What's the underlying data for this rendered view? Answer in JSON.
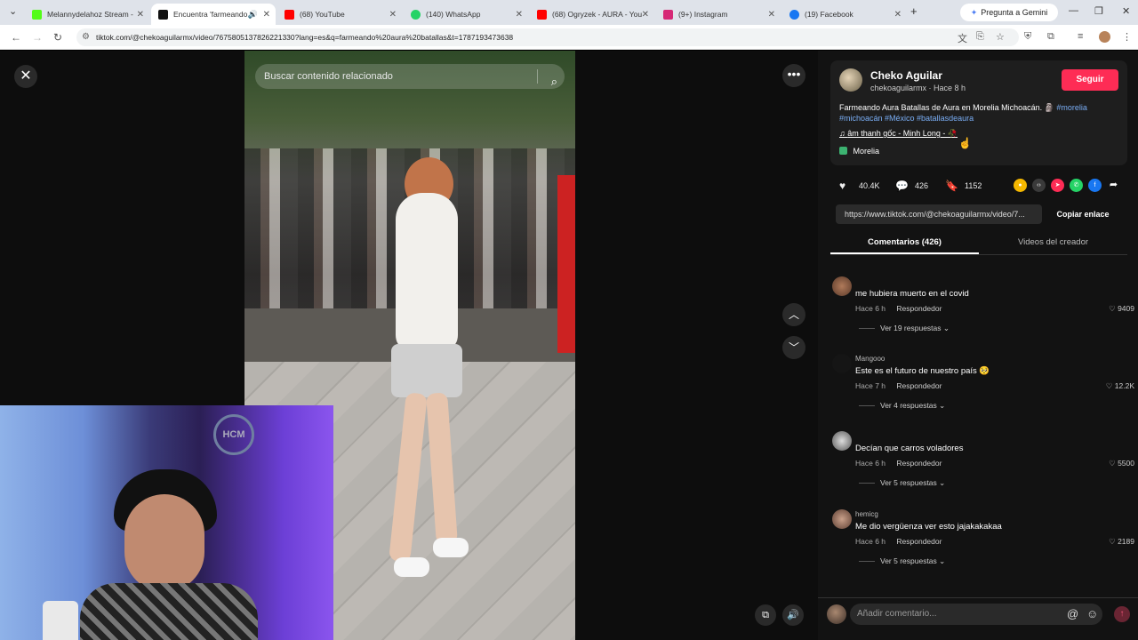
{
  "browser": {
    "tabs": [
      {
        "title": "Melannydelahoz Stream -",
        "color": "#53fc18"
      },
      {
        "title": "Encuentra 'farmeando",
        "color": "#111111",
        "active": true
      },
      {
        "title": "(68) YouTube",
        "color": "#ff0000"
      },
      {
        "title": "(140) WhatsApp",
        "color": "#25d366"
      },
      {
        "title": "(68) Ogryzek - AURA - You",
        "color": "#ff0000"
      },
      {
        "title": "(9+) Instagram",
        "color": "#d62976"
      },
      {
        "title": "(19) Facebook",
        "color": "#1877f2"
      }
    ],
    "gemini_label": "Pregunta a Gemini",
    "url": "tiktok.com/@chekoaguilarmx/video/7675805137826221330?lang=es&q=farmeando%20aura%20batallas&t=1787193473638"
  },
  "video": {
    "search_placeholder": "Buscar contenido relacionado",
    "webcam_logo": "HCM"
  },
  "creator": {
    "name": "Cheko Aguilar",
    "handle_time": "chekoaguilarmx · Hace 8 h",
    "follow_label": "Seguir",
    "description": "Farmeando Aura Batallas de Aura en Morelia Michoacán. 🗿",
    "tags_line1": "#morelia",
    "tags_line2": "#michoacán #México #batallasdeaura",
    "music": "âm thanh gốc - Minh Long - 🥀",
    "location": "Morelia"
  },
  "stats": {
    "likes": "40.4K",
    "comments": "426",
    "saves": "1152"
  },
  "share": {
    "link": "https://www.tiktok.com/@chekoaguilarmx/video/7...",
    "copy_label": "Copiar enlace"
  },
  "tabs": {
    "comments": "Comentarios (426)",
    "creator_videos": "Videos del creador"
  },
  "comments": [
    {
      "author": "",
      "text": "me hubiera muerto en el covid",
      "time": "Hace 6 h",
      "reply": "Respondedor",
      "likes": "9409",
      "more": "Ver 19 respuestas"
    },
    {
      "author": "Mangooo",
      "text": "Este es el futuro de nuestro país 🥺",
      "time": "Hace 7 h",
      "reply": "Respondedor",
      "likes": "12.2K",
      "more": "Ver 4 respuestas"
    },
    {
      "author": "",
      "text": "Decían que carros voladores",
      "time": "Hace 6 h",
      "reply": "Respondedor",
      "likes": "5500",
      "more": "Ver 5 respuestas"
    },
    {
      "author": "hemicg",
      "text": "Me dio vergüenza ver esto jajakakakaa",
      "time": "Hace 6 h",
      "reply": "Respondedor",
      "likes": "2189",
      "more": "Ver 5 respuestas"
    }
  ],
  "comment_input": {
    "placeholder": "Añadir comentario..."
  }
}
